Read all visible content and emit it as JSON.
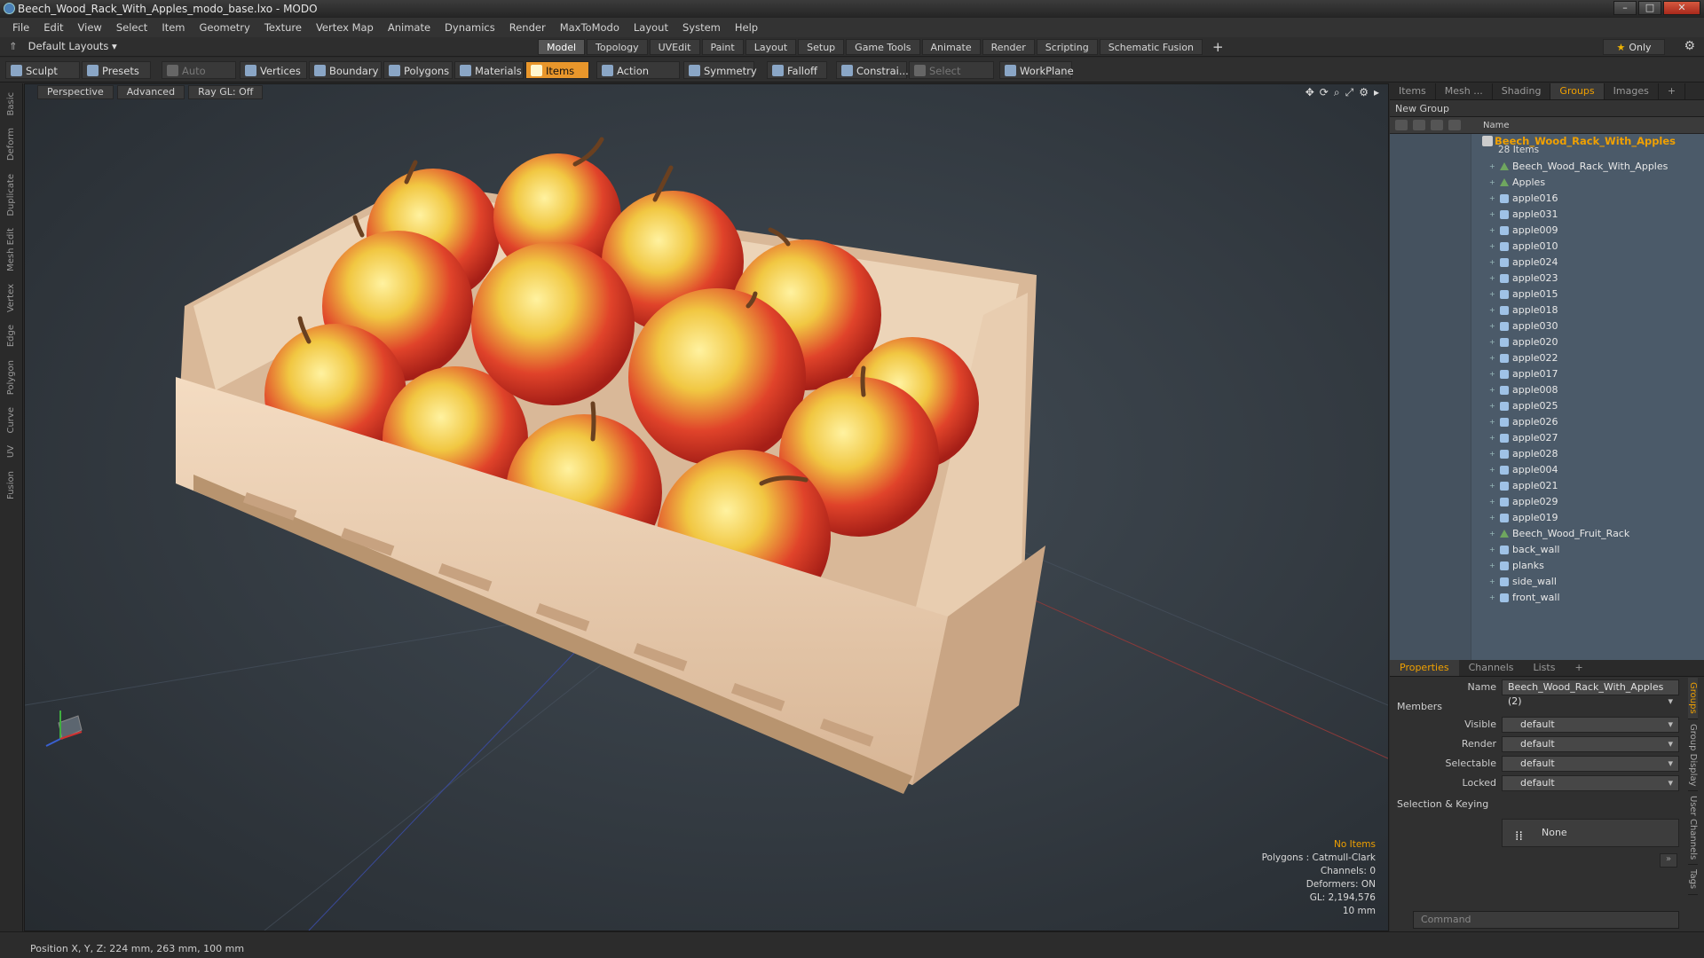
{
  "window": {
    "title": "Beech_Wood_Rack_With_Apples_modo_base.lxo - MODO"
  },
  "menu": [
    "File",
    "Edit",
    "View",
    "Select",
    "Item",
    "Geometry",
    "Texture",
    "Vertex Map",
    "Animate",
    "Dynamics",
    "Render",
    "MaxToModo",
    "Layout",
    "System",
    "Help"
  ],
  "layout": {
    "default_layouts": "Default Layouts ▾",
    "tabs": [
      "Model",
      "Topology",
      "UVEdit",
      "Paint",
      "Layout",
      "Setup",
      "Game Tools",
      "Animate",
      "Render",
      "Scripting",
      "Schematic Fusion"
    ],
    "active_tab": "Model",
    "only_label": "Only"
  },
  "toolbar": {
    "sculpt": "Sculpt",
    "presets": "Presets",
    "auto_select": "Auto Select",
    "vertices": "Vertices",
    "boundary": "Boundary",
    "polygons": "Polygons",
    "materials": "Materials",
    "items": "Items",
    "action_center": "Action Center",
    "symmetry": "Symmetry",
    "falloff": "Falloff",
    "constrain": "Constrai...",
    "select_through": "Select Through",
    "workplane": "WorkPlane"
  },
  "left_strip": [
    "Basic",
    "Deform",
    "Duplicate",
    "Mesh Edit",
    "Vertex",
    "Edge",
    "Polygon",
    "Curve",
    "UV",
    "Fusion"
  ],
  "viewport": {
    "view": "Perspective",
    "advanced": "Advanced",
    "raygl": "Ray GL: Off",
    "info": {
      "items": "No Items",
      "polygons": "Polygons : Catmull-Clark",
      "channels": "Channels: 0",
      "deformers": "Deformers: ON",
      "gl": "GL: 2,194,576",
      "scale": "10 mm"
    }
  },
  "status": {
    "position": "Position X, Y, Z:  224 mm, 263 mm, 100 mm"
  },
  "groups_panel": {
    "tabs": [
      "Items",
      "Mesh ...",
      "Shading",
      "Groups",
      "Images"
    ],
    "active": "Groups",
    "new_group": "New Group",
    "name_col": "Name",
    "root_name": "Beech_Wood_Rack_With_Apples",
    "root_count": "28 Items",
    "rows": [
      {
        "label": "Beech_Wood_Rack_With_Apples",
        "type": "loc"
      },
      {
        "label": "Apples",
        "type": "loc"
      },
      {
        "label": "apple016",
        "type": "mesh"
      },
      {
        "label": "apple031",
        "type": "mesh"
      },
      {
        "label": "apple009",
        "type": "mesh"
      },
      {
        "label": "apple010",
        "type": "mesh"
      },
      {
        "label": "apple024",
        "type": "mesh"
      },
      {
        "label": "apple023",
        "type": "mesh"
      },
      {
        "label": "apple015",
        "type": "mesh"
      },
      {
        "label": "apple018",
        "type": "mesh"
      },
      {
        "label": "apple030",
        "type": "mesh"
      },
      {
        "label": "apple020",
        "type": "mesh"
      },
      {
        "label": "apple022",
        "type": "mesh"
      },
      {
        "label": "apple017",
        "type": "mesh"
      },
      {
        "label": "apple008",
        "type": "mesh"
      },
      {
        "label": "apple025",
        "type": "mesh"
      },
      {
        "label": "apple026",
        "type": "mesh"
      },
      {
        "label": "apple027",
        "type": "mesh"
      },
      {
        "label": "apple028",
        "type": "mesh"
      },
      {
        "label": "apple004",
        "type": "mesh"
      },
      {
        "label": "apple021",
        "type": "mesh"
      },
      {
        "label": "apple029",
        "type": "mesh"
      },
      {
        "label": "apple019",
        "type": "mesh"
      },
      {
        "label": "Beech_Wood_Fruit_Rack",
        "type": "loc"
      },
      {
        "label": "back_wall",
        "type": "mesh"
      },
      {
        "label": "planks",
        "type": "mesh"
      },
      {
        "label": "side_wall",
        "type": "mesh"
      },
      {
        "label": "front_wall",
        "type": "mesh"
      }
    ]
  },
  "properties": {
    "tabs": [
      "Properties",
      "Channels",
      "Lists"
    ],
    "name_label": "Name",
    "name_value": "Beech_Wood_Rack_With_Apples (2)",
    "members": "Members",
    "visible_label": "Visible",
    "visible": "default",
    "render_label": "Render",
    "render": "default",
    "selectable_label": "Selectable",
    "selectable": "default",
    "locked_label": "Locked",
    "locked": "default",
    "selection_keying": "Selection & Keying",
    "none": "None",
    "side_tabs": [
      "Groups",
      "Group Display",
      "User Channels",
      "Tags"
    ],
    "command_placeholder": "Command"
  }
}
